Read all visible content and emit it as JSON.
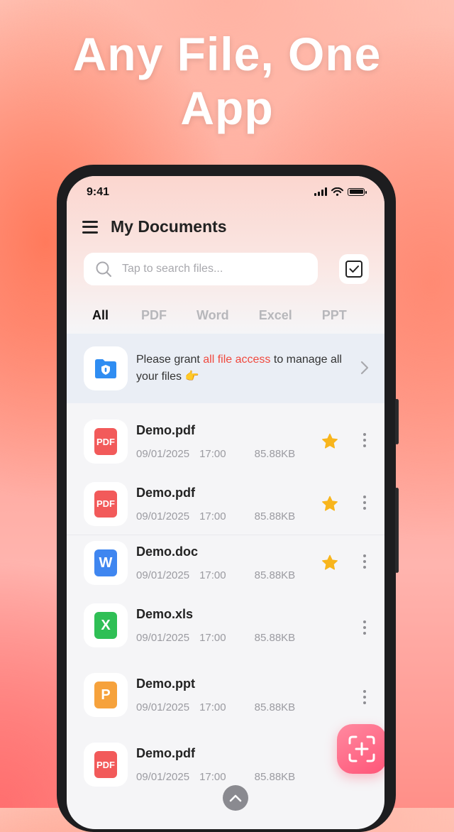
{
  "headline": {
    "line1": "Any File, One",
    "line2": "App"
  },
  "status_bar": {
    "time": "9:41"
  },
  "header": {
    "title": "My Documents"
  },
  "search": {
    "placeholder": "Tap to search files..."
  },
  "tabs": [
    {
      "label": "All",
      "active": true
    },
    {
      "label": "PDF",
      "active": false
    },
    {
      "label": "Word",
      "active": false
    },
    {
      "label": "Excel",
      "active": false
    },
    {
      "label": "PPT",
      "active": false
    }
  ],
  "banner": {
    "text_before": "Please grant ",
    "text_highlight": "all file access",
    "text_after": " to manage all your files 👉",
    "highlight_color": "#f0493e"
  },
  "files": [
    {
      "name": "Demo.pdf",
      "date": "09/01/2025",
      "time": "17:00",
      "size": "85.88KB",
      "type": "PDF",
      "color": "#f25a5a",
      "starred": true
    },
    {
      "name": "Demo.pdf",
      "date": "09/01/2025",
      "time": "17:00",
      "size": "85.88KB",
      "type": "PDF",
      "color": "#f25a5a",
      "starred": true
    },
    {
      "name": "Demo.doc",
      "date": "09/01/2025",
      "time": "17:00",
      "size": "85.88KB",
      "type": "W",
      "color": "#3f86f0",
      "starred": true
    },
    {
      "name": "Demo.xls",
      "date": "09/01/2025",
      "time": "17:00",
      "size": "85.88KB",
      "type": "X",
      "color": "#2fbf55",
      "starred": false
    },
    {
      "name": "Demo.ppt",
      "date": "09/01/2025",
      "time": "17:00",
      "size": "85.88KB",
      "type": "P",
      "color": "#f6a23c",
      "starred": false
    },
    {
      "name": "Demo.pdf",
      "date": "09/01/2025",
      "time": "17:00",
      "size": "85.88KB",
      "type": "PDF",
      "color": "#f25a5a",
      "starred": false
    }
  ],
  "colors": {
    "star": "#f8b51c",
    "fab": "#ff5578",
    "banner_bg": "#eaeef5"
  },
  "icons": [
    "menu-icon",
    "search-icon",
    "select-checkbox-icon",
    "shield-folder-icon",
    "chevron-right-icon",
    "star-icon",
    "more-vertical-icon",
    "scan-icon",
    "chevron-up-icon"
  ]
}
